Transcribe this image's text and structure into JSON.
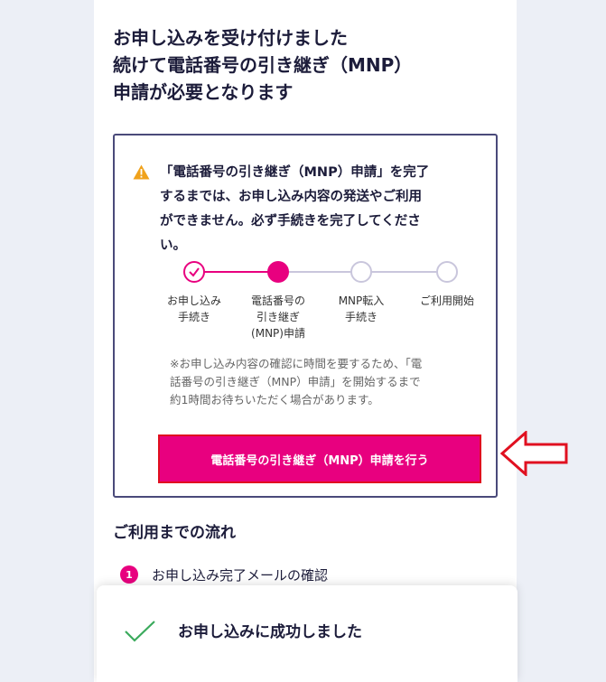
{
  "headline": {
    "line1": "お申し込みを受け付けました",
    "line2": "続けて電話番号の引き継ぎ（MNP）",
    "line3": "申請が必要となります"
  },
  "notice": {
    "icon": "warning-icon",
    "lines": [
      "「電話番号の引き継ぎ（MNP）申請」を完了",
      "するまでは、お申し込み内容の発送やご利用",
      "ができません。必ず手続きを完了してくださ",
      "い。"
    ]
  },
  "steps": [
    {
      "lines": [
        "お申し込み",
        "手続き"
      ],
      "state": "done"
    },
    {
      "lines": [
        "電話番号の",
        "引き継ぎ",
        "(MNP)申請"
      ],
      "state": "current"
    },
    {
      "lines": [
        "MNP転入",
        "手続き"
      ],
      "state": "todo"
    },
    {
      "lines": [
        "ご利用開始"
      ],
      "state": "todo"
    }
  ],
  "note": {
    "lines": [
      "※お申し込み内容の確認に時間を要するため、「電",
      "話番号の引き継ぎ（MNP）申請」を開始するまで",
      "約1時間お待ちいただく場合があります。"
    ]
  },
  "button": {
    "label": "電話番号の引き継ぎ（MNP）申請を行う"
  },
  "flow": {
    "title": "ご利用までの流れ",
    "items": [
      {
        "num": "1",
        "text": "お申し込み完了メールの確認"
      }
    ]
  },
  "toast": {
    "text": "お申し込みに成功しました",
    "icon": "checkmark-icon"
  },
  "colors": {
    "accent": "#e8007f",
    "toast_check": "#3aaa5c",
    "callout": "#e01020"
  }
}
